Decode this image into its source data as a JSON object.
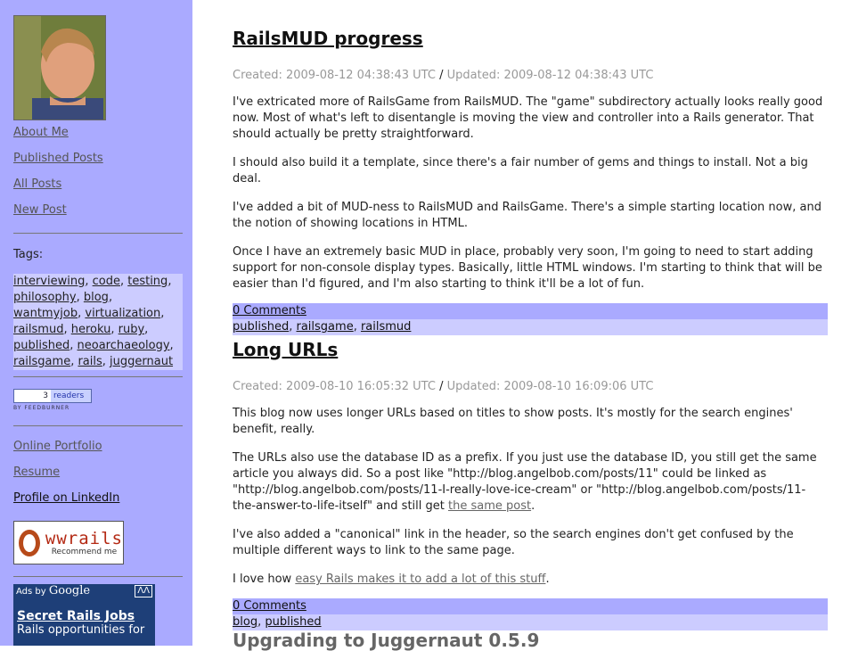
{
  "sidebar": {
    "nav": [
      "About Me",
      "Published Posts",
      "All Posts",
      "New Post"
    ],
    "tags_title": "Tags:",
    "tags": [
      "interviewing",
      "code",
      "testing",
      "philosophy",
      "blog",
      "wantmyjob",
      "virtualization",
      "railsmud",
      "heroku",
      "ruby",
      "published",
      "neoarchaeology",
      "railsgame",
      "rails",
      "juggernaut"
    ],
    "feedburner": {
      "count": "3",
      "label": "readers",
      "by": "BY FEEDBURNER"
    },
    "links": [
      "Online Portfolio",
      "Resume",
      "Profile on LinkedIn"
    ],
    "wwrails": {
      "brand": "wwrails",
      "recommend": "Recommend me"
    },
    "ads": {
      "by": "Ads by",
      "google": "Google",
      "nav": "ΛɅ",
      "headline": "Secret Rails Jobs",
      "line": "Rails opportunities for"
    }
  },
  "posts": [
    {
      "title": "RailsMUD progress",
      "created": "Created: 2009-08-12 04:38:43 UTC",
      "separator": "/",
      "updated": "Updated: 2009-08-12 04:38:43 UTC",
      "paragraphs": [
        "I've extricated more of RailsGame from RailsMUD. The \"game\" subdirectory actually looks really good now. Most of what's left to disentangle is moving the view and controller into a Rails generator. That should actually be pretty straightforward.",
        "I should also build it a template, since there's a fair number of gems and things to install. Not a big deal.",
        "I've added a bit of MUD-ness to RailsMUD and RailsGame. There's a simple starting location now, and the notion of showing locations in HTML.",
        "Once I have an extremely basic MUD in place, probably very soon, I'm going to need to start adding support for non-console display types. Basically, little HTML windows. I'm starting to think that will be easier than I'd figured, and I'm also starting to think it'll be a lot of fun."
      ],
      "comments": "0 Comments",
      "tags": [
        "published",
        "railsgame",
        "railsmud"
      ]
    },
    {
      "title": "Long URLs",
      "created": "Created: 2009-08-10 16:05:32 UTC",
      "separator": "/",
      "updated": "Updated: 2009-08-10 16:09:06 UTC",
      "p1": "This blog now uses longer URLs based on titles to show posts. It's mostly for the search engines' benefit, really.",
      "p2_text": "The URLs also use the database ID as a prefix. If you just use the database ID, you still get the same article you always did. So a post like \"http://blog.angelbob.com/posts/11\" could be linked as \"http://blog.angelbob.com/posts/11-I-really-love-ice-cream\" or \"http://blog.angelbob.com/posts/11-the-answer-to-life-itself\" and still get ",
      "p2_link": "the same post",
      "p2_end": ".",
      "p3": "I've also added a \"canonical\" link in the header, so the search engines don't get confused by the multiple different ways to link to the same page.",
      "p4_text": "I love how ",
      "p4_link": "easy Rails makes it to add a lot of this stuff",
      "p4_end": ".",
      "comments": "0 Comments",
      "tags": [
        "blog",
        "published"
      ]
    }
  ],
  "next_post_title": "Upgrading to Juggernaut 0.5.9"
}
